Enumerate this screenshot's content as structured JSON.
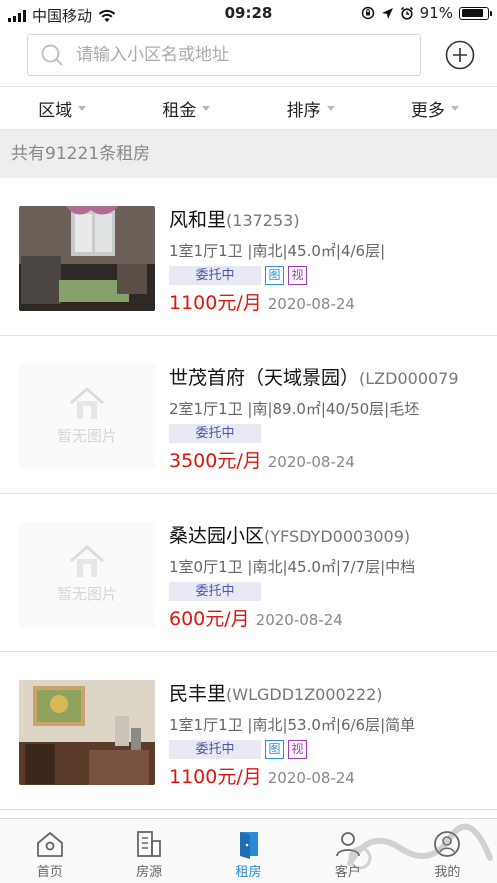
{
  "status": {
    "carrier": "中国移动",
    "time": "09:28",
    "battery": "91%",
    "battery_level": 0.91
  },
  "search": {
    "placeholder": "请输入小区名或地址"
  },
  "filters": [
    "区域",
    "租金",
    "排序",
    "更多"
  ],
  "count_text": "共有91221条租房",
  "listings": [
    {
      "title": "风和里",
      "code": "(137253)",
      "info": "1室1厅1卫 |南北|45.0㎡|4/6层|",
      "tag": "委托中",
      "tu": "图",
      "shi": "视",
      "price": "1100元/月",
      "date": "2020-08-24",
      "has_photo": true
    },
    {
      "title": "世茂首府（天域景园）",
      "code": "(LZD000079",
      "info": "2室1厅1卫 |南|89.0㎡|40/50层|毛坯",
      "tag": "委托中",
      "price": "3500元/月",
      "date": "2020-08-24",
      "no_photo": "暂无图片"
    },
    {
      "title": "桑达园小区",
      "code": "(YFSDYD0003009)",
      "info": "1室0厅1卫 |南北|45.0㎡|7/7层|中档",
      "tag": "委托中",
      "price": "600元/月",
      "date": "2020-08-24",
      "no_photo": "暂无图片"
    },
    {
      "title": "民丰里",
      "code": "(WLGDD1Z000222)",
      "info": "1室1厅1卫 |南北|53.0㎡|6/6层|简单",
      "tag": "委托中",
      "tu": "图",
      "shi": "视",
      "price": "1100元/月",
      "date": "2020-08-24",
      "has_photo": true
    }
  ],
  "tabs": [
    {
      "label": "首页",
      "icon": "home-icon"
    },
    {
      "label": "房源",
      "icon": "building-icon"
    },
    {
      "label": "租房",
      "icon": "door-icon",
      "active": true
    },
    {
      "label": "客户",
      "icon": "user-icon"
    },
    {
      "label": "我的",
      "icon": "profile-icon"
    }
  ],
  "colors": {
    "accent": "#2a8ad6",
    "price": "#e0150f",
    "tag_bg": "#e9e9f6",
    "tag_text": "#4b56a6"
  }
}
